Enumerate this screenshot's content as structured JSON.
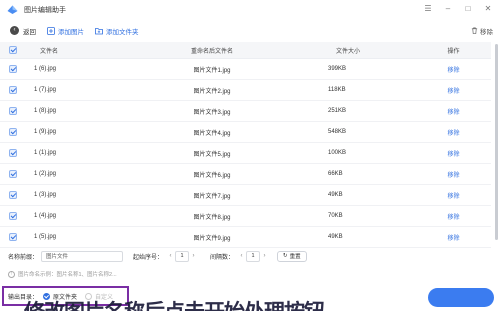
{
  "app": {
    "title": "图片编辑助手"
  },
  "toolbar": {
    "back": "返回",
    "add_image": "添加图片",
    "add_folder": "添加文件夹",
    "delete": "移除"
  },
  "table": {
    "headers": {
      "name": "文件名",
      "rename": "重命名后文件名",
      "size": "文件大小",
      "action": "操作"
    },
    "rows": [
      {
        "name": "1 (6).jpg",
        "rename": "图片文件1.jpg",
        "size": "399KB",
        "action": "移除"
      },
      {
        "name": "1 (7).jpg",
        "rename": "图片文件2.jpg",
        "size": "118KB",
        "action": "移除"
      },
      {
        "name": "1 (8).jpg",
        "rename": "图片文件3.jpg",
        "size": "251KB",
        "action": "移除"
      },
      {
        "name": "1 (9).jpg",
        "rename": "图片文件4.jpg",
        "size": "548KB",
        "action": "移除"
      },
      {
        "name": "1 (1).jpg",
        "rename": "图片文件5.jpg",
        "size": "100KB",
        "action": "移除"
      },
      {
        "name": "1 (2).jpg",
        "rename": "图片文件6.jpg",
        "size": "66KB",
        "action": "移除"
      },
      {
        "name": "1 (3).jpg",
        "rename": "图片文件7.jpg",
        "size": "49KB",
        "action": "移除"
      },
      {
        "name": "1 (4).jpg",
        "rename": "图片文件8.jpg",
        "size": "70KB",
        "action": "移除"
      },
      {
        "name": "1 (5).jpg",
        "rename": "图片文件9.jpg",
        "size": "49KB",
        "action": "移除"
      }
    ]
  },
  "naming": {
    "prefix_label": "名称前缀：",
    "prefix_value": "图片文件",
    "start_label": "起始序号：",
    "start_value": "1",
    "step_label": "间隔数：",
    "step_value": "1",
    "reset": "重置"
  },
  "hint": "图片命名示例：图片名称1、图片名称2...",
  "output": {
    "label": "输出目录：",
    "option_original": "原文件夹",
    "option_custom": "自定义"
  },
  "overlay_caption": "修改图片名称后点击开始处理按钮"
}
